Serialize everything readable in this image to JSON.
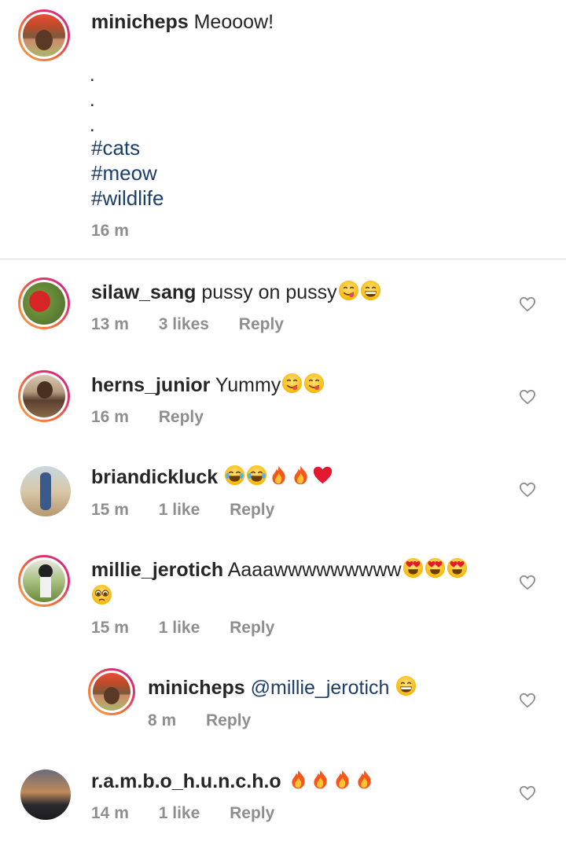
{
  "caption": {
    "username": "minicheps",
    "text": "Meooow!",
    "dots": [
      ".",
      ".",
      "."
    ],
    "hashtags": [
      "#cats",
      "#meow",
      "#wildlife"
    ],
    "time": "16 m"
  },
  "comments": [
    {
      "username": "silaw_sang",
      "text": "pussy on pussy",
      "emojis": [
        "yum-emoji",
        "grin-emoji"
      ],
      "time": "13 m",
      "likes": "3 likes",
      "reply": "Reply"
    },
    {
      "username": "herns_junior",
      "text": "Yummy",
      "emojis": [
        "yum-emoji",
        "yum-emoji"
      ],
      "time": "16 m",
      "likes": "",
      "reply": "Reply"
    },
    {
      "username": "briandickluck",
      "text": "",
      "emojis": [
        "joy-emoji",
        "joy-emoji",
        "fire-emoji",
        "fire-emoji",
        "heart-emoji"
      ],
      "time": "15 m",
      "likes": "1 like",
      "reply": "Reply"
    },
    {
      "username": "millie_jerotich",
      "text": "Aaaawwwwwwwww",
      "emojis": [
        "heart-eyes-emoji",
        "heart-eyes-emoji",
        "heart-eyes-emoji"
      ],
      "emojis_line2": [
        "pleading-emoji"
      ],
      "time": "15 m",
      "likes": "1 like",
      "reply": "Reply"
    },
    {
      "username": "minicheps",
      "mention": "@millie_jerotich",
      "text": "",
      "emojis": [
        "grin-emoji"
      ],
      "time": "8 m",
      "likes": "",
      "reply": "Reply"
    },
    {
      "username": "r.a.m.b.o_h.u.n.c.h.o",
      "text": "",
      "emojis": [
        "fire-emoji",
        "fire-emoji",
        "fire-emoji",
        "fire-emoji"
      ],
      "time": "14 m",
      "likes": "1 like",
      "reply": "Reply"
    }
  ],
  "colors": {
    "link": "#1b3e6b",
    "meta": "#8e8e8e",
    "divider": "#dbdbdb"
  }
}
